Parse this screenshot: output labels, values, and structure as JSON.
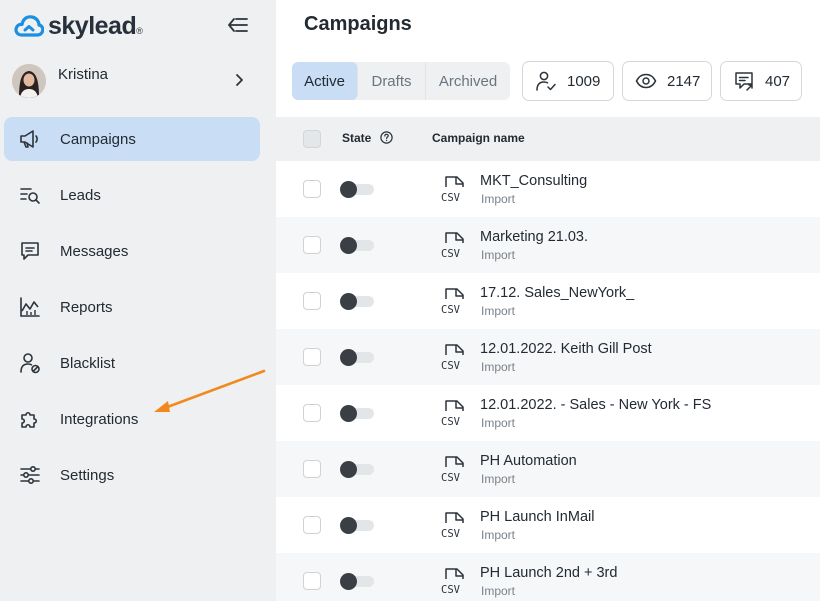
{
  "brand": {
    "name": "skylead",
    "reg": "®"
  },
  "user": {
    "name": "Kristina"
  },
  "nav": [
    {
      "label": "Campaigns",
      "icon": "megaphone-icon",
      "active": true
    },
    {
      "label": "Leads",
      "icon": "leads-search-icon",
      "active": false
    },
    {
      "label": "Messages",
      "icon": "message-icon",
      "active": false
    },
    {
      "label": "Reports",
      "icon": "chart-icon",
      "active": false
    },
    {
      "label": "Blacklist",
      "icon": "user-blocked-icon",
      "active": false
    },
    {
      "label": "Integrations",
      "icon": "puzzle-icon",
      "active": false
    },
    {
      "label": "Settings",
      "icon": "sliders-icon",
      "active": false
    }
  ],
  "page": {
    "title": "Campaigns"
  },
  "tabs": [
    {
      "label": "Active",
      "active": true
    },
    {
      "label": "Drafts",
      "active": false
    },
    {
      "label": "Archived",
      "active": false
    }
  ],
  "stats": [
    {
      "icon": "user-check-icon",
      "value": "1009"
    },
    {
      "icon": "eye-icon",
      "value": "2147"
    },
    {
      "icon": "reply-message-icon",
      "value": "407"
    }
  ],
  "table": {
    "headers": {
      "state": "State",
      "name": "Campaign name"
    },
    "rows": [
      {
        "name": "MKT_Consulting",
        "sub": "Import"
      },
      {
        "name": "Marketing 21.03.",
        "sub": "Import"
      },
      {
        "name": "17.12. Sales_NewYork_",
        "sub": "Import"
      },
      {
        "name": "12.01.2022. Keith Gill Post",
        "sub": "Import"
      },
      {
        "name": "12.01.2022. - Sales - New York - FS",
        "sub": "Import"
      },
      {
        "name": "PH Automation",
        "sub": "Import"
      },
      {
        "name": "PH Launch InMail",
        "sub": "Import"
      },
      {
        "name": "PH Launch 2nd + 3rd",
        "sub": "Import"
      }
    ],
    "csv_label": "CSV"
  },
  "colors": {
    "accent": "#c9def5",
    "brand": "#1b8fe0",
    "annotation": "#f2891f"
  }
}
